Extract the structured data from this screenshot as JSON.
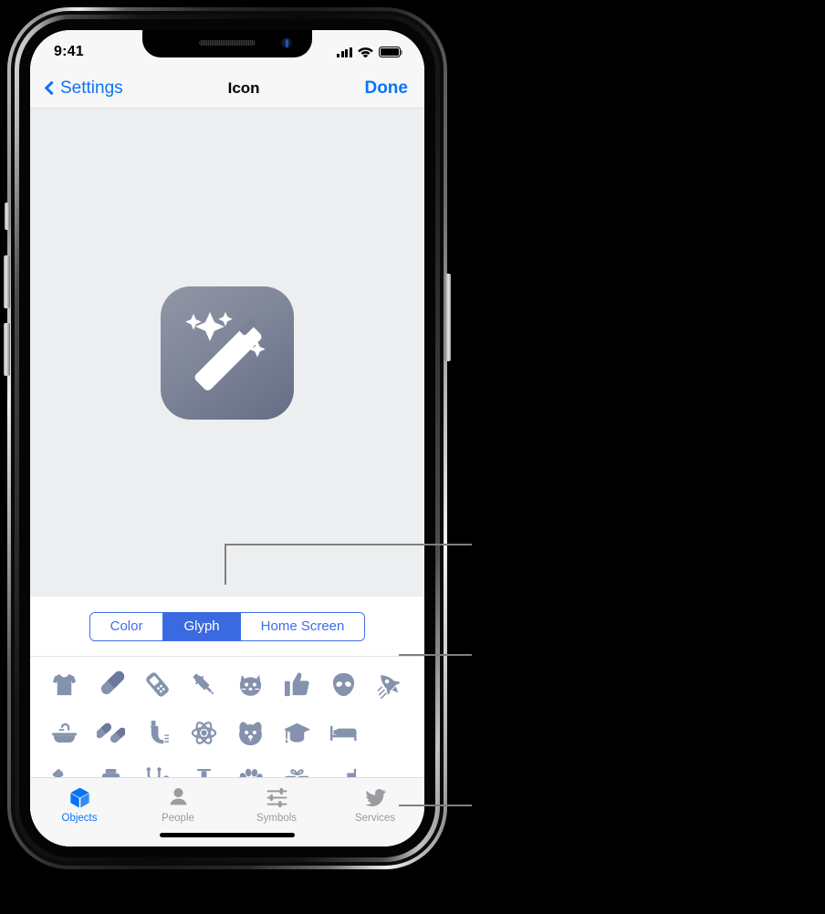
{
  "status_bar": {
    "time": "9:41",
    "signal_icon": "cellular-bars-icon",
    "wifi_icon": "wifi-icon",
    "battery_icon": "battery-icon"
  },
  "nav_bar": {
    "back_label": "Settings",
    "back_icon": "chevron-left-icon",
    "title": "Icon",
    "done_label": "Done"
  },
  "preview": {
    "app_icon_name": "magic-wand-app-icon",
    "icon_gradient_start": "#9097a6",
    "icon_gradient_end": "#656d85",
    "background": "#eceef0"
  },
  "segmented_control": {
    "selected": "Glyph",
    "accent": "#3a69e0",
    "options": [
      {
        "label": "Color",
        "selected": false
      },
      {
        "label": "Glyph",
        "selected": true
      },
      {
        "label": "Home Screen",
        "selected": false
      }
    ]
  },
  "glyph_grid": {
    "color": "#8592ad",
    "rows": [
      [
        {
          "name": "tshirt-glyph"
        },
        {
          "name": "capsule-pill-glyph"
        },
        {
          "name": "game-controller-glyph"
        },
        {
          "name": "syringe-glyph"
        },
        {
          "name": "cat-face-glyph"
        },
        {
          "name": "thumbs-up-glyph"
        },
        {
          "name": "alien-glyph"
        },
        {
          "name": "rocket-glyph"
        }
      ],
      [
        {
          "name": "bathtub-glyph"
        },
        {
          "name": "two-pills-glyph"
        },
        {
          "name": "inhaler-glyph"
        },
        {
          "name": "atom-glyph"
        },
        {
          "name": "dog-face-glyph"
        },
        {
          "name": "graduation-cap-glyph"
        },
        {
          "name": "bed-glyph"
        }
      ],
      [
        {
          "name": "shower-glyph"
        },
        {
          "name": "medicine-bottle-glyph"
        },
        {
          "name": "stethoscope-glyph"
        },
        {
          "name": "flask-glyph"
        },
        {
          "name": "paw-print-glyph"
        },
        {
          "name": "gift-glyph"
        },
        {
          "name": "stairs-glyph"
        }
      ]
    ]
  },
  "tab_bar": {
    "active_color": "#0a74f5",
    "inactive_color": "#9b9ba0",
    "tabs": [
      {
        "label": "Objects",
        "icon": "cube-icon",
        "active": true
      },
      {
        "label": "People",
        "icon": "person-icon",
        "active": false
      },
      {
        "label": "Symbols",
        "icon": "sliders-icon",
        "active": false
      },
      {
        "label": "Services",
        "icon": "twitter-bird-icon",
        "active": false
      }
    ]
  },
  "callouts": {
    "line_color": "#808080",
    "count": 3
  }
}
